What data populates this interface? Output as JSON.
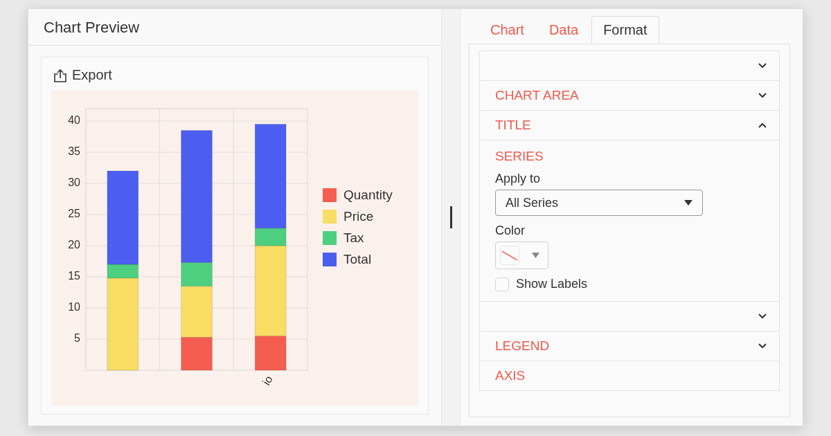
{
  "preview": {
    "title": "Chart Preview",
    "export_label": "Export",
    "chart_data": {
      "type": "bar",
      "stacked": true,
      "orientation": "vertical",
      "grid": true,
      "legend": true,
      "categories": [
        null,
        null,
        "io"
      ],
      "ylim": [
        0,
        42
      ],
      "yticks": [
        {
          "value": 5,
          "label": "5"
        },
        {
          "value": 10,
          "label": "10"
        },
        {
          "value": 15,
          "label": "15"
        },
        {
          "value": 20,
          "label": "20"
        },
        {
          "value": 25,
          "label": "25"
        },
        {
          "value": 30,
          "label": "30"
        },
        {
          "value": 35,
          "label": "35"
        },
        {
          "value": 40,
          "label": "40"
        }
      ],
      "series": [
        {
          "name": "Quantity",
          "color": "#f45d50",
          "values": [
            null,
            5.3,
            5.5
          ]
        },
        {
          "name": "Price",
          "color": "#f9dc63",
          "values": [
            14.8,
            8.2,
            14.5
          ]
        },
        {
          "name": "Tax",
          "color": "#4dcf80",
          "values": [
            2.2,
            3.8,
            2.8
          ]
        },
        {
          "name": "Total",
          "color": "#4b5ef0",
          "values": [
            15,
            21.2,
            16.7
          ]
        }
      ]
    }
  },
  "editor": {
    "tabs": [
      {
        "label": "Chart",
        "selected": false
      },
      {
        "label": "Data",
        "selected": false
      },
      {
        "label": "Format",
        "selected": true
      }
    ],
    "sections": [
      {
        "kind": "header",
        "expanded": false
      },
      {
        "kind": "header",
        "title": "CHART AREA",
        "expanded": false
      },
      {
        "kind": "header",
        "title": "TITLE",
        "expanded": true
      },
      {
        "kind": "panel",
        "title": "SERIES",
        "apply_to": {
          "label": "Apply to",
          "value": "All Series"
        },
        "color_field": {
          "label": "Color"
        },
        "show_labels": {
          "label": "Show Labels",
          "checked": false
        }
      },
      {
        "kind": "header",
        "expanded": false
      },
      {
        "kind": "header",
        "title": "LEGEND",
        "expanded": false
      },
      {
        "kind": "header",
        "title": "AXIS"
      }
    ]
  }
}
